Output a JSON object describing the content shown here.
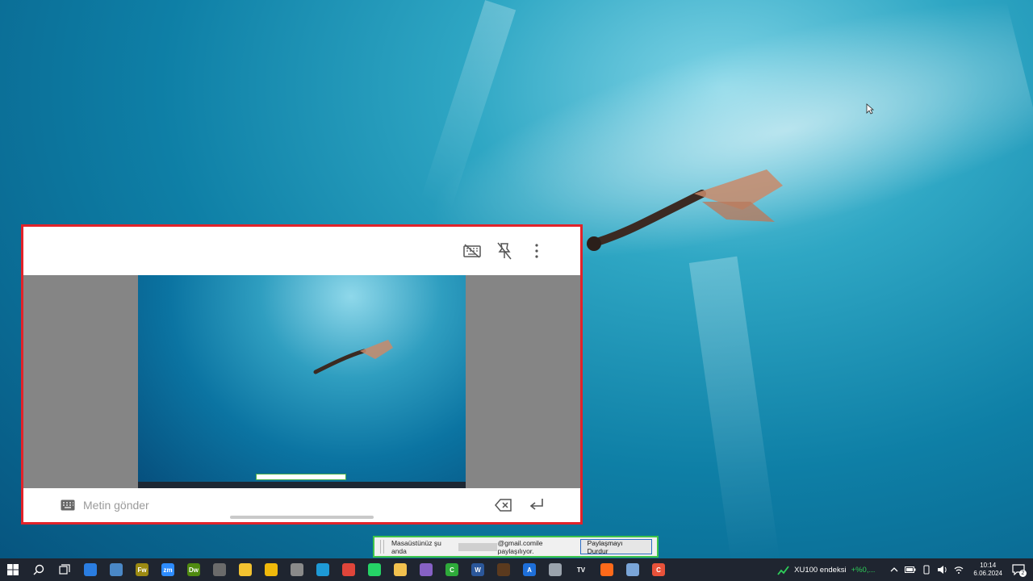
{
  "desktop": {
    "wallpaper": "underwater-freediver"
  },
  "phone_window": {
    "send_placeholder": "Metin gönder",
    "toolbar_icons": [
      "keyboard-off-icon",
      "unpin-icon",
      "more-vert-icon"
    ],
    "bottom_icons": [
      "keyboard-icon",
      "backspace-icon",
      "enter-icon"
    ]
  },
  "share_bar": {
    "text_before": "Masaüstünüz şu anda",
    "text_after": "@gmail.comile paylaşılıyor.",
    "stop_label": "Paylaşmayı Durdur",
    "accent": "#3ec44a"
  },
  "taskbar": {
    "apps": [
      {
        "name": "mail-app-icon",
        "label": "",
        "color": "#2a7de1"
      },
      {
        "name": "computer-app-icon",
        "label": "",
        "color": "#4a88c7"
      },
      {
        "name": "fireworks-app-icon",
        "label": "Fw",
        "color": "#9c8a12"
      },
      {
        "name": "zoom-app-icon",
        "label": "zm",
        "color": "#2d8cff"
      },
      {
        "name": "dreamweaver-app-icon",
        "label": "Dw",
        "color": "#4f8a10"
      },
      {
        "name": "calculator-app-icon",
        "label": "",
        "color": "#6b6b6b"
      },
      {
        "name": "sticky-notes-app-icon",
        "label": "",
        "color": "#f2c230"
      },
      {
        "name": "binance-app-icon",
        "label": "",
        "color": "#f0b90b"
      },
      {
        "name": "cube-app-icon",
        "label": "",
        "color": "#8a8a8a"
      },
      {
        "name": "edge-app-icon",
        "label": "",
        "color": "#1e9ad6"
      },
      {
        "name": "chrome-app-icon",
        "label": "",
        "color": "#e0453a"
      },
      {
        "name": "whatsapp-app-icon",
        "label": "",
        "color": "#25d366"
      },
      {
        "name": "file-explorer-app-icon",
        "label": "",
        "color": "#f2c14e"
      },
      {
        "name": "visual-studio-app-icon",
        "label": "",
        "color": "#8661c5"
      },
      {
        "name": "camtasia-app-icon",
        "label": "C",
        "color": "#2eaa3a"
      },
      {
        "name": "word-app-icon",
        "label": "W",
        "color": "#2b579a"
      },
      {
        "name": "game-app-icon",
        "label": "",
        "color": "#5b3a1e"
      },
      {
        "name": "affinity-app-icon",
        "label": "A",
        "color": "#1e6fd9"
      },
      {
        "name": "disc-app-icon",
        "label": "",
        "color": "#9aa3ad"
      },
      {
        "name": "tradingview-app-icon",
        "label": "TV",
        "color": "#1f2530"
      },
      {
        "name": "orange-app-icon",
        "label": "",
        "color": "#ff6a1a"
      },
      {
        "name": "phone-link-app-icon",
        "label": "",
        "color": "#7aa5d8"
      },
      {
        "name": "c-app-icon",
        "label": "C",
        "color": "#e8523a"
      }
    ],
    "stock_name": "XU100 endeksi",
    "stock_change": "+%0,...",
    "time": "10:14",
    "date": "6.06.2024",
    "notification_count": "2"
  }
}
